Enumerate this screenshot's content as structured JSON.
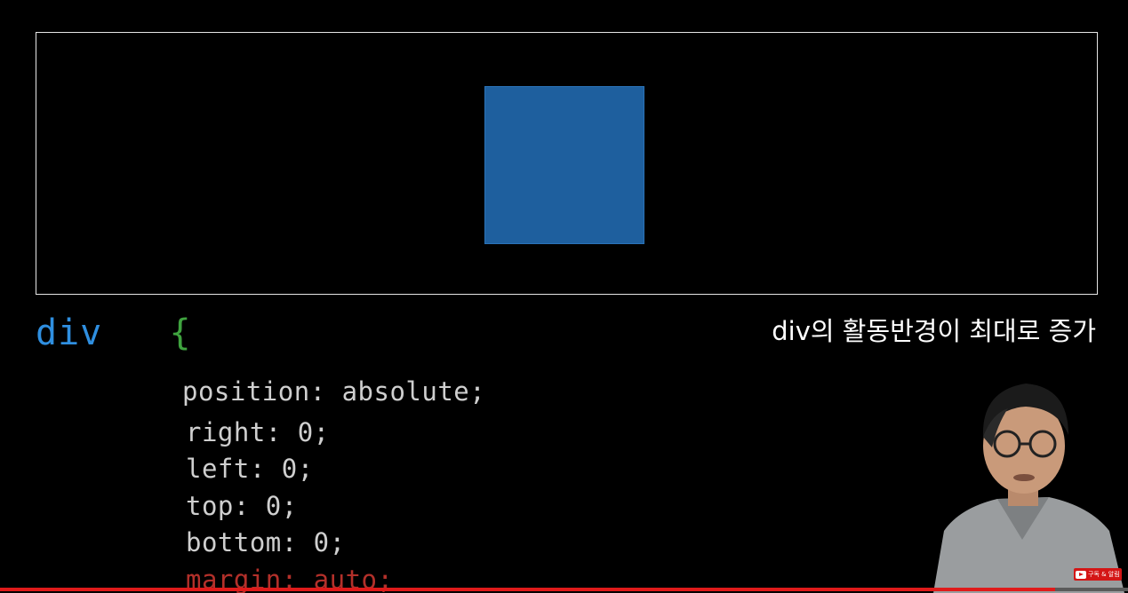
{
  "slide": {
    "selector": "div",
    "open_brace": "{",
    "caption": "div의 활동반경이 최대로 증가",
    "code_lines": [
      "position: absolute;",
      "right: 0;",
      "left: 0;",
      "top: 0;",
      "bottom: 0;",
      "margin: auto;"
    ]
  },
  "colors": {
    "background": "#000000",
    "box_border": "#e6e6e6",
    "square": "#1e5f9e",
    "selector": "#2f8fe0",
    "brace": "#3fa33f",
    "code_text": "#cfcfcf",
    "code_highlight": "#b3302a",
    "progress": "#e01a1a"
  },
  "video": {
    "progress": 0.935,
    "subscribe_badge": "구독 & 알림",
    "badge_icon": "youtube-play-icon"
  }
}
